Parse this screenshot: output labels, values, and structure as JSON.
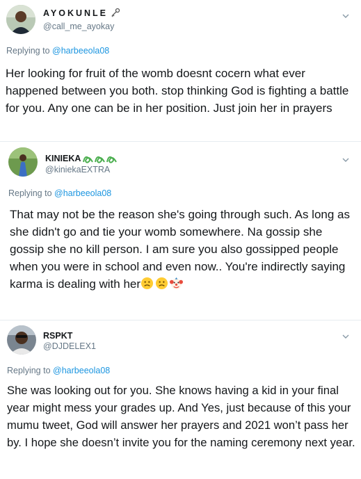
{
  "tweets": [
    {
      "display_name": "AYOKUNLE",
      "handle": "@call_me_ayokay",
      "replying_label": "Replying to",
      "replying_to": "@harbeeola08",
      "text": "Her looking for fruit of the womb doesnt cocern what ever happened between you both. stop thinking God is fighting a battle for you. Any one can be in her position. Just join her in prayers",
      "name_icon": "key-icon"
    },
    {
      "display_name": "KINIEKA",
      "handle": "@kiniekaEXTRA",
      "replying_label": "Replying to",
      "replying_to": "@harbeeola08",
      "text": "That may not be the reason she's going through such. As long as she didn't go and tie your womb somewhere. Na gossip she gossip she no kill person. I am sure you also gossipped people when you were in school and even now.. You're indirectly saying karma is dealing with her",
      "name_icon": "green-loops-emoji",
      "trailing_emojis": [
        "worried-face-emoji",
        "worried-face-emoji",
        "clown-face-emoji"
      ]
    },
    {
      "display_name": "RSPKT",
      "handle": "@DJDELEX1",
      "replying_label": "Replying to",
      "replying_to": "@harbeeola08",
      "text": "She was looking out for you.  She knows having a kid in your final year might mess your grades up. And Yes, just because of this your mumu tweet, God will answer her prayers and 2021 won’t pass her by. I hope she doesn’t invite you for the naming ceremony next year."
    }
  ],
  "colors": {
    "text": "#14171a",
    "secondary": "#657786",
    "mention": "#1b95e0",
    "divider": "#e6ecf0",
    "loops_green": "#4caf50"
  }
}
